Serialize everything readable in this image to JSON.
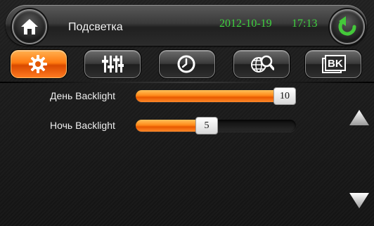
{
  "header": {
    "title": "Подсветка",
    "date": "2012-10-19",
    "time": "17:13"
  },
  "tabs": [
    {
      "icon": "gear-icon",
      "active": true
    },
    {
      "icon": "equalizer-icon",
      "active": false
    },
    {
      "icon": "clock-icon",
      "active": false
    },
    {
      "icon": "globe-search-icon",
      "active": false
    },
    {
      "icon": "bk-keyboard-icon",
      "label": "BK",
      "active": false
    }
  ],
  "settings": {
    "day_backlight": {
      "label": "День Backlight",
      "value": "10",
      "level": 1.0
    },
    "night_backlight": {
      "label": "Ночь Backlight",
      "value": "5",
      "level": 0.5
    }
  },
  "colors": {
    "accent_orange": "#ff7a10",
    "clock_green": "#3fd23f",
    "back_arrow_green": "#44c83a"
  }
}
